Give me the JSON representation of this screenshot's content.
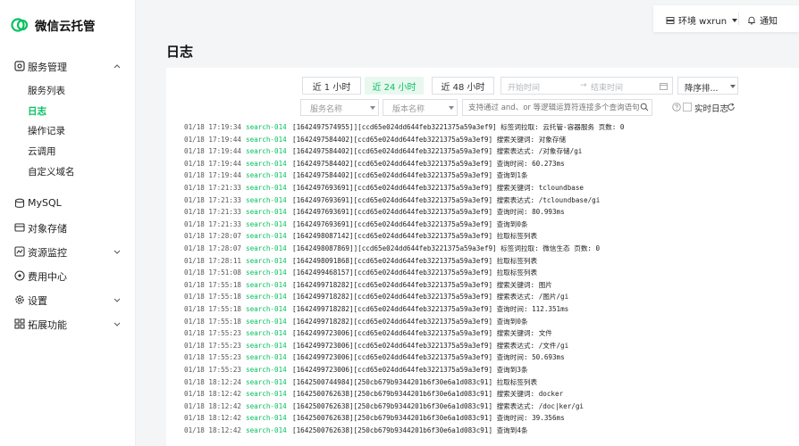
{
  "app": {
    "name": "微信云托管"
  },
  "topbar": {
    "env_label": "环境 wxrun",
    "notice_label": "通知"
  },
  "page": {
    "title": "日志"
  },
  "sidebar": {
    "sections": [
      {
        "label": "服务管理",
        "icon": "service-icon",
        "expanded": true,
        "items": [
          "服务列表",
          "日志",
          "操作记录",
          "云调用",
          "自定义域名"
        ],
        "active_item": "日志"
      },
      {
        "label": "MySQL",
        "icon": "database-icon"
      },
      {
        "label": "对象存储",
        "icon": "storage-icon"
      },
      {
        "label": "资源监控",
        "icon": "monitor-icon",
        "expandable": true
      },
      {
        "label": "费用中心",
        "icon": "billing-icon"
      },
      {
        "label": "设置",
        "icon": "settings-icon",
        "expandable": true
      },
      {
        "label": "拓展功能",
        "icon": "extension-icon",
        "expandable": true
      }
    ]
  },
  "filters": {
    "time_buttons": [
      "近 1 小时",
      "近 24 小时",
      "近 48 小时"
    ],
    "active_time": "近 24 小时",
    "start_placeholder": "开始时间",
    "end_placeholder": "结束时间",
    "range_separator": "→",
    "sort_label": "降序排...",
    "service_placeholder": "服务名称",
    "version_placeholder": "版本名称",
    "query_placeholder": "支持通过 and、or 等逻辑运算符连接多个查询语句",
    "realtime_label": "实时日志",
    "realtime_checked": false
  },
  "logs": [
    {
      "time": "01/18 17:19:34",
      "source": "search-014",
      "message": "[1642497574955]][ccd65e024dd644feb3221375a59a3ef9] 标签词拉取: 云托管-容器服务 页数: 0"
    },
    {
      "time": "01/18 17:19:44",
      "source": "search-014",
      "message": "[1642497584402][ccd65e024dd644feb3221375a59a3ef9] 搜索关键词: 对象存储"
    },
    {
      "time": "01/18 17:19:44",
      "source": "search-014",
      "message": "[1642497584402][ccd65e024dd644feb3221375a59a3ef9] 搜索表达式: /对象存储/gi"
    },
    {
      "time": "01/18 17:19:44",
      "source": "search-014",
      "message": "[1642497584402][ccd65e024dd644feb3221375a59a3ef9] 查询时间: 60.273ms"
    },
    {
      "time": "01/18 17:19:44",
      "source": "search-014",
      "message": "[1642497584402][ccd65e024dd644feb3221375a59a3ef9] 查询到1条"
    },
    {
      "time": "01/18 17:21:33",
      "source": "search-014",
      "message": "[1642497693691][ccd65e024dd644feb3221375a59a3ef9] 搜索关键词: tcloundbase"
    },
    {
      "time": "01/18 17:21:33",
      "source": "search-014",
      "message": "[1642497693691][ccd65e024dd644feb3221375a59a3ef9] 搜索表达式: /tcloundbase/gi"
    },
    {
      "time": "01/18 17:21:33",
      "source": "search-014",
      "message": "[1642497693691][ccd65e024dd644feb3221375a59a3ef9] 查询时间: 80.993ms"
    },
    {
      "time": "01/18 17:21:33",
      "source": "search-014",
      "message": "[1642497693691][ccd65e024dd644feb3221375a59a3ef9] 查询到0条"
    },
    {
      "time": "01/18 17:28:07",
      "source": "search-014",
      "message": "[1642498087142][ccd65e024dd644feb3221375a59a3ef9] 拉取标签列表"
    },
    {
      "time": "01/18 17:28:07",
      "source": "search-014",
      "message": "[1642498087869]][ccd65e024dd644feb3221375a59a3ef9] 标签词拉取: 微信生态 页数: 0"
    },
    {
      "time": "01/18 17:28:11",
      "source": "search-014",
      "message": "[1642498091868][ccd65e024dd644feb3221375a59a3ef9] 拉取标签列表"
    },
    {
      "time": "01/18 17:51:08",
      "source": "search-014",
      "message": "[1642499468157][ccd65e024dd644feb3221375a59a3ef9] 拉取标签列表"
    },
    {
      "time": "01/18 17:55:18",
      "source": "search-014",
      "message": "[1642499718282][ccd65e024dd644feb3221375a59a3ef9] 搜索关键词: 图片"
    },
    {
      "time": "01/18 17:55:18",
      "source": "search-014",
      "message": "[1642499718282][ccd65e024dd644feb3221375a59a3ef9] 搜索表达式: /图片/gi"
    },
    {
      "time": "01/18 17:55:18",
      "source": "search-014",
      "message": "[1642499718282][ccd65e024dd644feb3221375a59a3ef9] 查询时间: 112.351ms"
    },
    {
      "time": "01/18 17:55:18",
      "source": "search-014",
      "message": "[1642499718282][ccd65e024dd644feb3221375a59a3ef9] 查询到0条"
    },
    {
      "time": "01/18 17:55:23",
      "source": "search-014",
      "message": "[1642499723006][ccd65e024dd644feb3221375a59a3ef9] 搜索关键词: 文件"
    },
    {
      "time": "01/18 17:55:23",
      "source": "search-014",
      "message": "[1642499723006][ccd65e024dd644feb3221375a59a3ef9] 搜索表达式: /文件/gi"
    },
    {
      "time": "01/18 17:55:23",
      "source": "search-014",
      "message": "[1642499723006][ccd65e024dd644feb3221375a59a3ef9] 查询时间: 50.693ms"
    },
    {
      "time": "01/18 17:55:23",
      "source": "search-014",
      "message": "[1642499723006][ccd65e024dd644feb3221375a59a3ef9] 查询到3条"
    },
    {
      "time": "01/18 18:12:24",
      "source": "search-014",
      "message": "[1642500744984][250cb679b9344201b6f30e6a1d083c91] 拉取标签列表"
    },
    {
      "time": "01/18 18:12:42",
      "source": "search-014",
      "message": "[1642500762638][250cb679b9344201b6f30e6a1d083c91] 搜索关键词: docker"
    },
    {
      "time": "01/18 18:12:42",
      "source": "search-014",
      "message": "[1642500762638][250cb679b9344201b6f30e6a1d083c91] 搜索表达式: /doc|ker/gi"
    },
    {
      "time": "01/18 18:12:42",
      "source": "search-014",
      "message": "[1642500762638][250cb679b9344201b6f30e6a1d083c91] 查询时间: 39.356ms"
    },
    {
      "time": "01/18 18:12:42",
      "source": "search-014",
      "message": "[1642500762638][250cb679b9344201b6f30e6a1d083c91] 查询到4条"
    }
  ],
  "colors": {
    "brand": "#07c160",
    "active_bg": "#e8f8ef"
  }
}
